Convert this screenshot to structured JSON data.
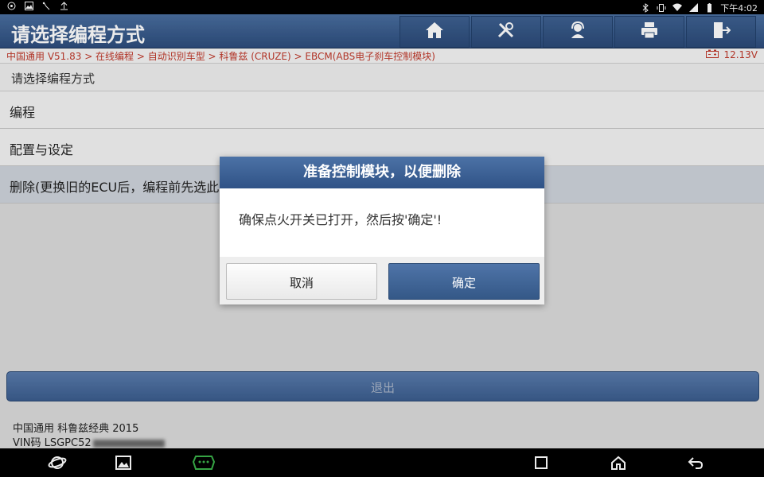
{
  "status_bar": {
    "time": "下午4:02",
    "left_icons": [
      "gps-icon",
      "image-icon",
      "vci-icon",
      "upload-icon"
    ],
    "right_icons": [
      "bluetooth-icon",
      "vibrate-icon",
      "wifi-icon",
      "signal-icon",
      "battery-icon"
    ]
  },
  "header": {
    "title": "请选择编程方式",
    "buttons": [
      "home-icon",
      "diagnose-tools-icon",
      "support-icon",
      "print-icon",
      "exit-door-icon"
    ]
  },
  "breadcrumb": {
    "path": "中国通用 V51.83 > 在线编程 > 自动识别车型 > 科鲁兹 (CRUZE) > EBCM(ABS电子刹车控制模块)",
    "voltage": "12.13V"
  },
  "subtitle": "请选择编程方式",
  "list": [
    {
      "label": "编程"
    },
    {
      "label": "配置与设定"
    },
    {
      "label": "删除(更换旧的ECU后，编程前先选此"
    }
  ],
  "exit_button": {
    "label": "退出"
  },
  "footer": {
    "vehicle": "中国通用 科鲁兹经典 2015",
    "vin_label": "VIN码 LSGPC52"
  },
  "dialog": {
    "title": "准备控制模块，以便删除",
    "message": "确保点火开关已打开，然后按'确定'!",
    "cancel": "取消",
    "ok": "确定"
  },
  "nav_bar": [
    "browser-icon",
    "gallery-icon",
    "vci-icon",
    "recent-apps-icon",
    "home-icon",
    "back-icon"
  ],
  "colors": {
    "header_blue": "#3b5d8e",
    "breadcrumb_red": "#c0392b",
    "vci_green": "#3bb24a"
  }
}
